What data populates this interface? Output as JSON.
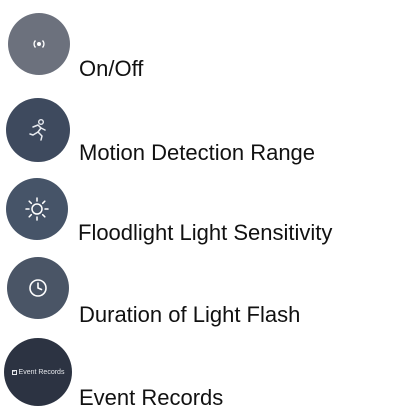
{
  "items": [
    {
      "label": "On/Off",
      "icon": "broadcast-icon",
      "color": "#6c717d"
    },
    {
      "label": "Motion Detection Range",
      "icon": "running-person-icon",
      "color": "#3e4a5e"
    },
    {
      "label": "Floodlight Light Sensitivity",
      "icon": "sun-icon",
      "color": "#465468"
    },
    {
      "label": "Duration of Light Flash",
      "icon": "clock-icon",
      "color": "#4a5566"
    },
    {
      "label": "Event Records",
      "icon": "event-records-icon",
      "color": "#2c3342",
      "badge_text": "Event Records"
    }
  ]
}
